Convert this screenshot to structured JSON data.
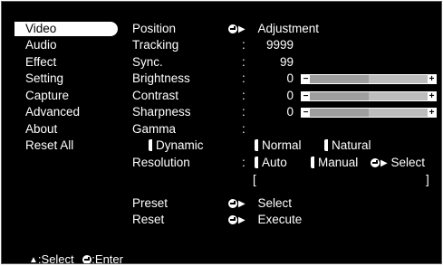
{
  "menu": [
    {
      "label": "Video",
      "selected": true
    },
    {
      "label": "Audio"
    },
    {
      "label": "Effect"
    },
    {
      "label": "Setting"
    },
    {
      "label": "Capture"
    },
    {
      "label": "Advanced"
    },
    {
      "label": "About"
    },
    {
      "label": "Reset All"
    }
  ],
  "settings": {
    "position": {
      "label": "Position",
      "value": "Adjustment"
    },
    "tracking": {
      "label": "Tracking",
      "colon": ":",
      "value": "9999"
    },
    "sync": {
      "label": "Sync.",
      "colon": ":",
      "value": "99"
    },
    "brightness": {
      "label": "Brightness",
      "colon": ":",
      "value": "0",
      "level": 0.5
    },
    "contrast": {
      "label": "Contrast",
      "colon": ":",
      "value": "0",
      "level": 0.5
    },
    "sharpness": {
      "label": "Sharpness",
      "colon": ":",
      "value": "0",
      "level": 0.5
    },
    "gamma": {
      "label": "Gamma",
      "colon": ":",
      "options": [
        "Dynamic",
        "Normal",
        "Natural"
      ]
    },
    "resolution": {
      "label": "Resolution",
      "colon": ":",
      "options": [
        "Auto",
        "Manual"
      ],
      "select": "Select",
      "bracket_open": "[",
      "bracket_close": "]"
    },
    "preset": {
      "label": "Preset",
      "value": "Select"
    },
    "reset": {
      "label": "Reset",
      "value": "Execute"
    }
  },
  "footer": {
    "select": ":Select",
    "enter": ":Enter"
  },
  "icons": {
    "enter": "enter-icon",
    "updown": "up-down-arrow-icon"
  }
}
